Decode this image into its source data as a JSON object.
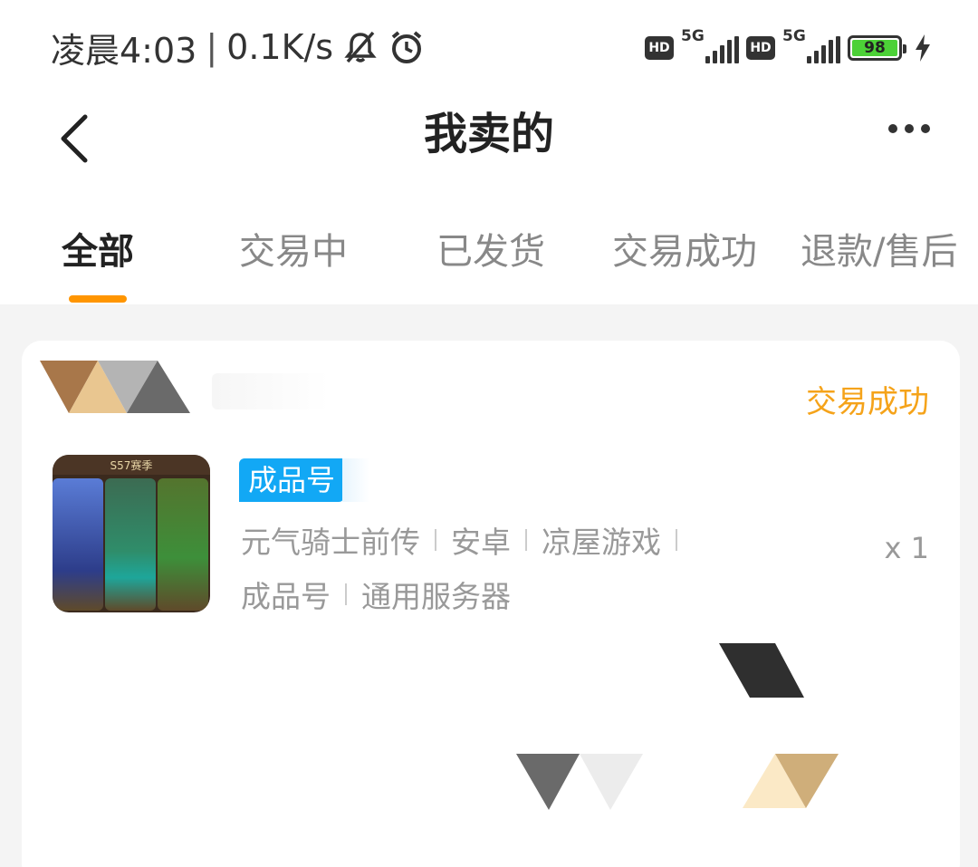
{
  "status_bar": {
    "time": "凌晨4:03",
    "separator": "|",
    "network_speed": "0.1K/s",
    "icons": [
      "mute-icon",
      "alarm-icon"
    ],
    "sim1": {
      "hd": "HD",
      "network": "5G"
    },
    "sim2": {
      "hd": "HD",
      "network": "5G"
    },
    "battery_level": "98",
    "charging_icon": "lightning-icon"
  },
  "header": {
    "title": "我卖的",
    "back_icon": "chevron-left-icon",
    "more_icon": "more-dots-icon"
  },
  "tabs": [
    {
      "label": "全部",
      "active": true
    },
    {
      "label": "交易中",
      "active": false
    },
    {
      "label": "已发货",
      "active": false
    },
    {
      "label": "交易成功",
      "active": false
    },
    {
      "label": "退款/售后",
      "active": false
    }
  ],
  "order": {
    "status": "交易成功",
    "tag": "成品号",
    "meta_line1": [
      "元气骑士前传",
      "安卓",
      "凉屋游戏"
    ],
    "meta_line2": [
      "成品号",
      "通用服务器"
    ],
    "quantity": "x 1",
    "thumbnail_banner": "S57赛季"
  },
  "colors": {
    "accent": "#ff9500",
    "status_success": "#f5a31a",
    "tag_bg": "#12a8f5",
    "battery_green": "#4cd137"
  }
}
